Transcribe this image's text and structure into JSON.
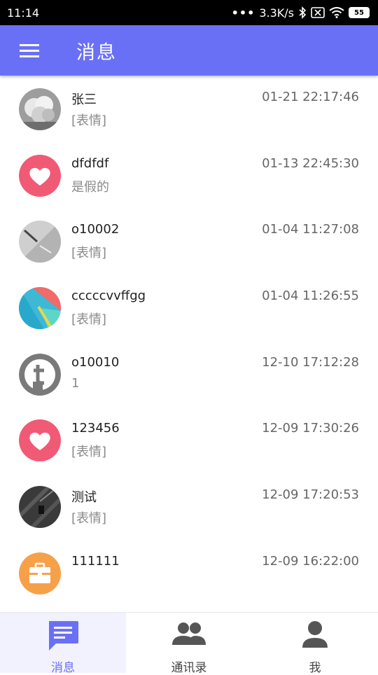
{
  "status_bar": {
    "time": "11:14",
    "network_speed": "3.3K/s",
    "battery": "55",
    "icons": [
      "dots-icon",
      "bluetooth-icon",
      "no-sim-icon",
      "wifi-icon",
      "battery-icon"
    ]
  },
  "app_bar": {
    "title": "消息",
    "menu_icon": "menu-icon"
  },
  "conversations": [
    {
      "name": "张三",
      "time": "01-21 22:17:46",
      "preview": "[表情]",
      "avatar": "photo-cloud"
    },
    {
      "name": "dfdfdf",
      "time": "01-13 22:45:30",
      "preview": "是假的",
      "avatar": "heart"
    },
    {
      "name": "o10002",
      "time": "01-04 11:27:08",
      "preview": "[表情]",
      "avatar": "photo-desk"
    },
    {
      "name": "cccccvvffgg",
      "time": "01-04 11:26:55",
      "preview": "[表情]",
      "avatar": "material"
    },
    {
      "name": "o10010",
      "time": "12-10 17:12:28",
      "preview": "1",
      "avatar": "t-logo"
    },
    {
      "name": "123456",
      "time": "12-09 17:30:26",
      "preview": "[表情]",
      "avatar": "heart"
    },
    {
      "name": "测试",
      "time": "12-09 17:20:53",
      "preview": "[表情]",
      "avatar": "photo-dark"
    },
    {
      "name": "111111",
      "time": "12-09 16:22:00",
      "preview": "",
      "avatar": "briefcase"
    }
  ],
  "bottom_nav": [
    {
      "label": "消息",
      "icon": "chat-icon",
      "active": true
    },
    {
      "label": "通讯录",
      "icon": "contacts-icon",
      "active": false
    },
    {
      "label": "我",
      "icon": "person-icon",
      "active": false
    }
  ],
  "colors": {
    "accent": "#6a70f5",
    "heart_bg": "#f15a75",
    "briefcase_bg": "#f7a04a"
  }
}
